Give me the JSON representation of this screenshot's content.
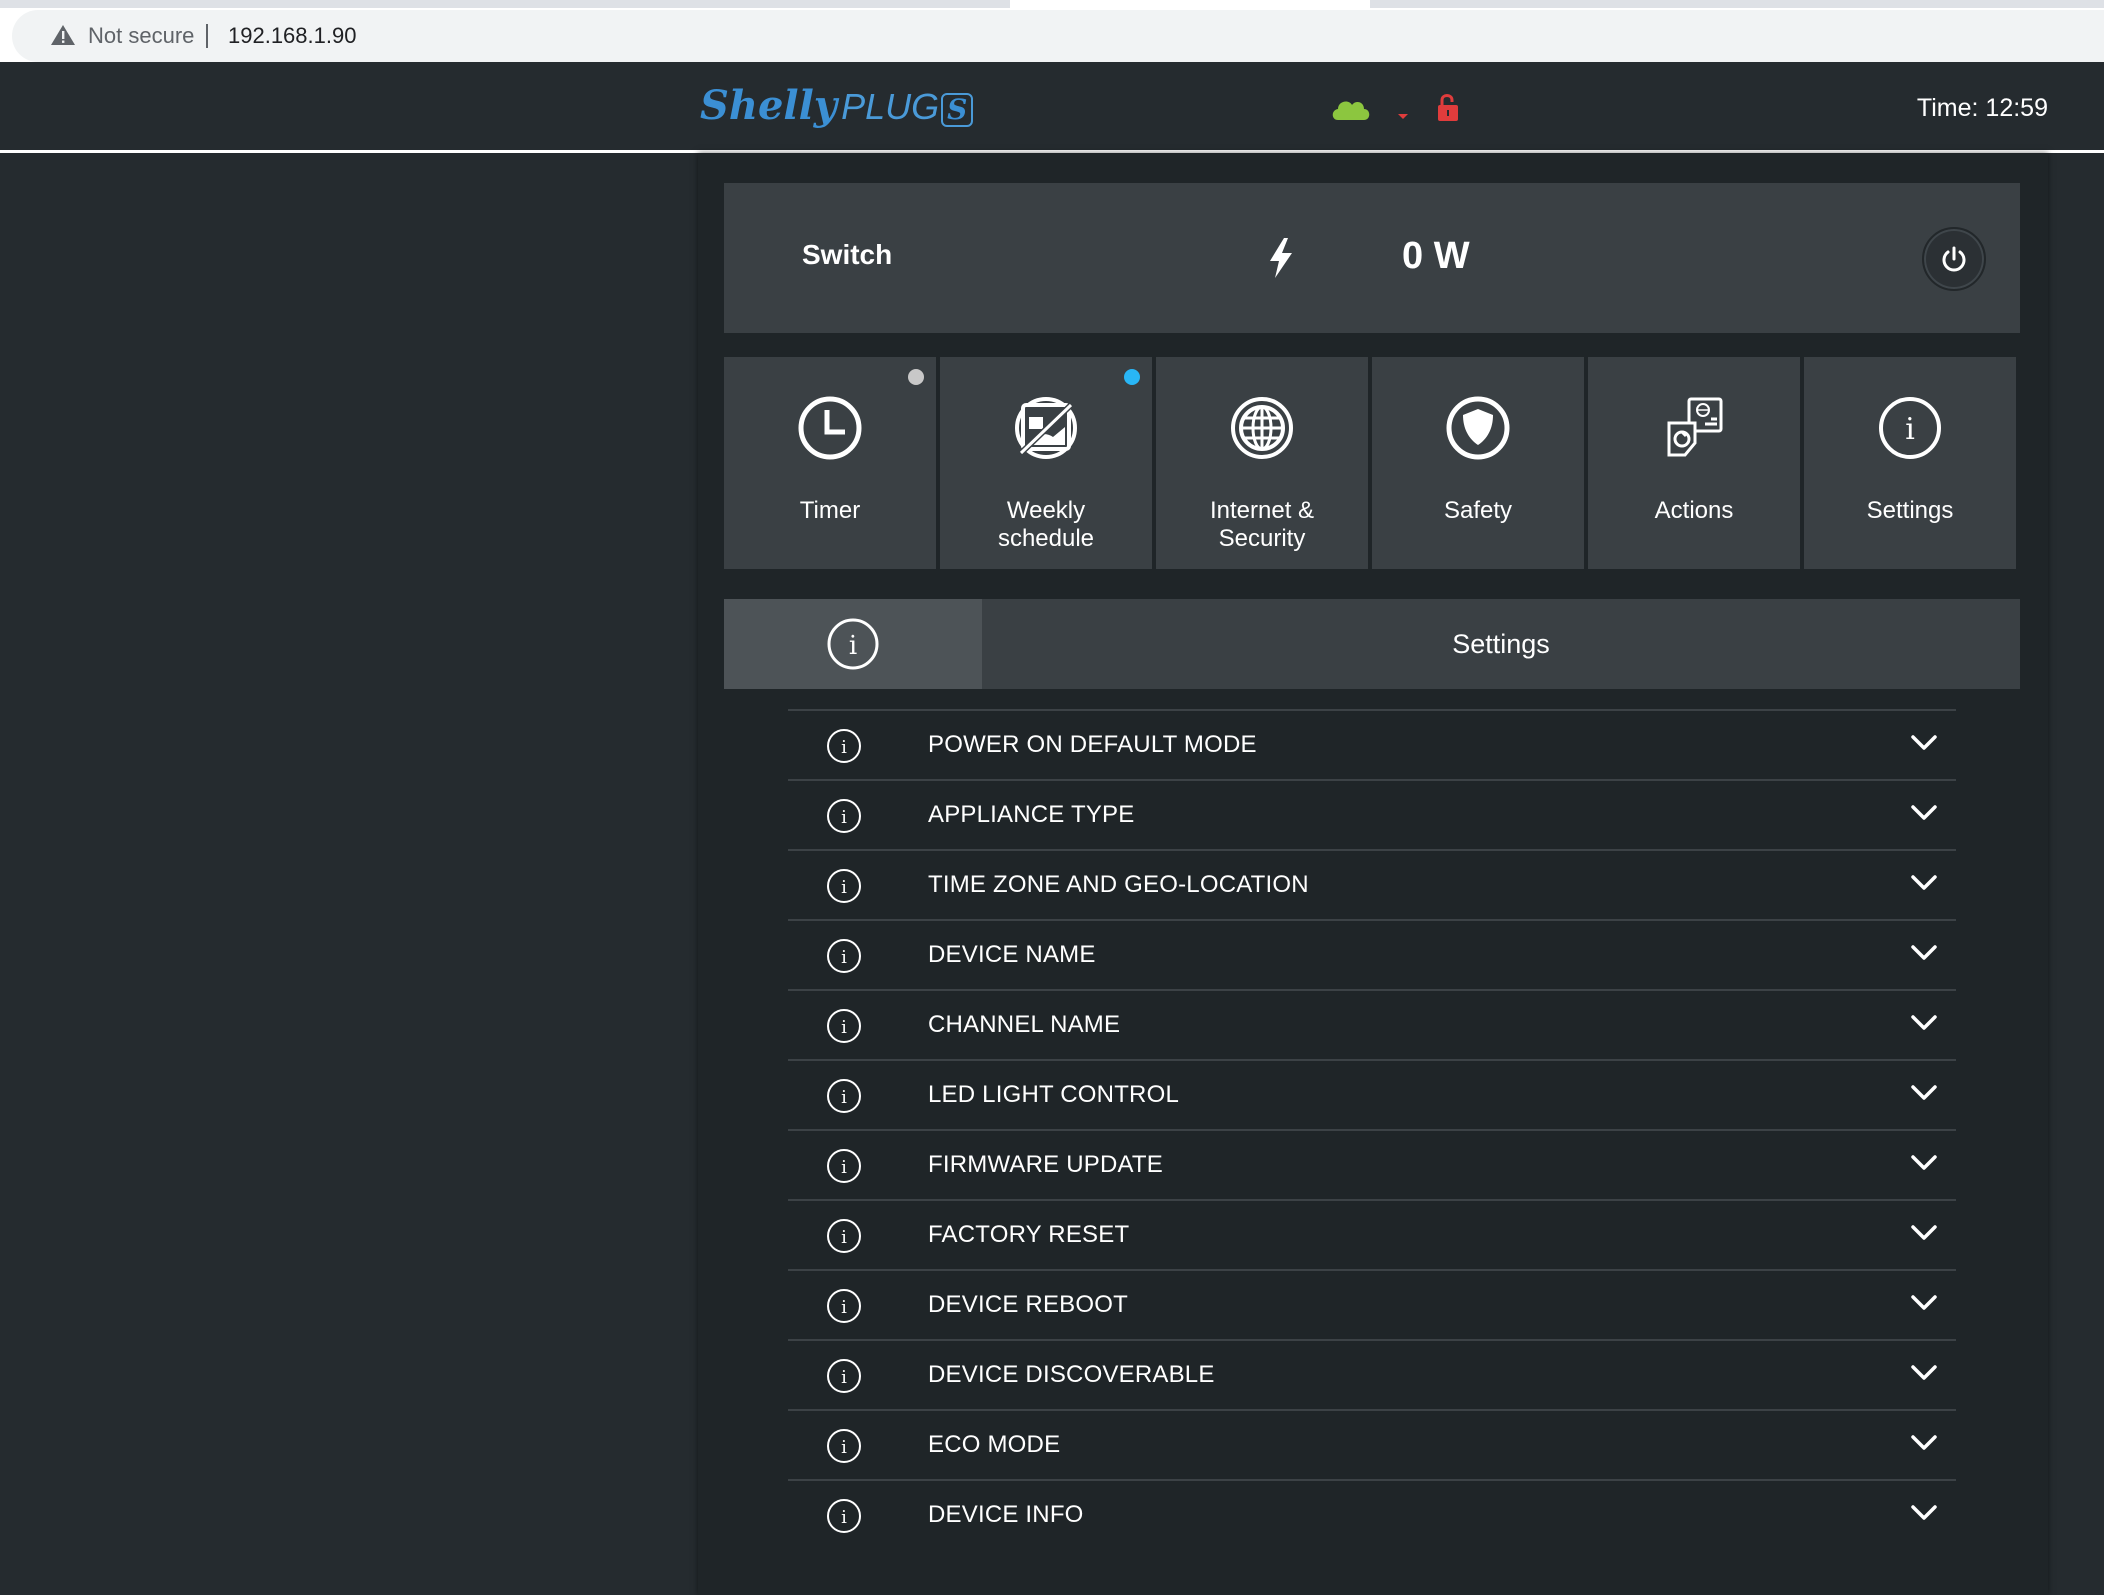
{
  "browser": {
    "security_label": "Not secure",
    "url": "192.168.1.90"
  },
  "header": {
    "logo_brand": "Shelly",
    "logo_model": "PLUG",
    "logo_badge": "S",
    "time": "Time: 12:59",
    "status_icons": [
      "cloud-icon",
      "signal-icon",
      "lock-open-icon"
    ],
    "colors": {
      "cloud": "#8cc63f",
      "signal": "#e03c3c",
      "lock": "#e03c3c",
      "brand": "#3b8fd4"
    }
  },
  "switch": {
    "label": "Switch",
    "power": "0 W"
  },
  "tiles": [
    {
      "label_line1": "Timer",
      "label_line2": "",
      "icon": "clock-icon",
      "dot_color": "#c8c8c8"
    },
    {
      "label_line1": "Weekly",
      "label_line2": "schedule",
      "icon": "calendar-off-icon",
      "dot_color": "#29b6f6"
    },
    {
      "label_line1": "Internet &",
      "label_line2": "Security",
      "icon": "globe-icon",
      "dot_color": ""
    },
    {
      "label_line1": "Safety",
      "label_line2": "",
      "icon": "shield-icon",
      "dot_color": ""
    },
    {
      "label_line1": "Actions",
      "label_line2": "",
      "icon": "actions-icon",
      "dot_color": ""
    },
    {
      "label_line1": "Settings",
      "label_line2": "",
      "icon": "info-icon",
      "dot_color": ""
    }
  ],
  "settings": {
    "title": "Settings",
    "rows": [
      "POWER ON DEFAULT MODE",
      "APPLIANCE TYPE",
      "TIME ZONE AND GEO-LOCATION",
      "DEVICE NAME",
      "CHANNEL NAME",
      "LED LIGHT CONTROL",
      "FIRMWARE UPDATE",
      "FACTORY RESET",
      "DEVICE REBOOT",
      "DEVICE DISCOVERABLE",
      "ECO MODE",
      "DEVICE INFO"
    ]
  }
}
